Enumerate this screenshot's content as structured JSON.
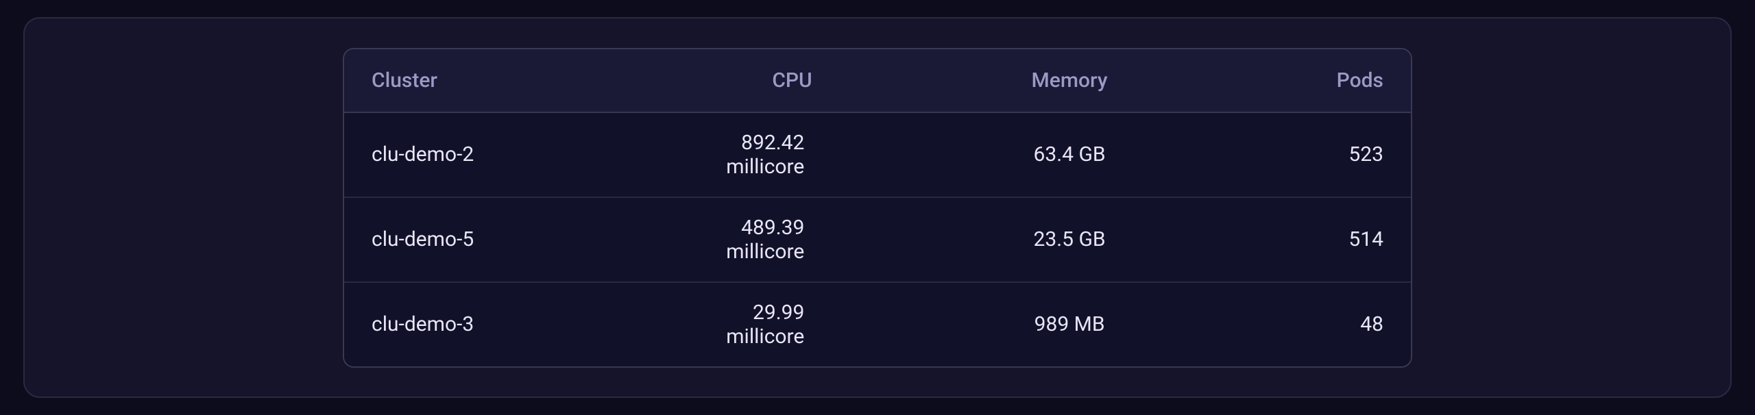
{
  "table": {
    "headers": {
      "cluster": "Cluster",
      "cpu": "CPU",
      "memory": "Memory",
      "pods": "Pods"
    },
    "rows": [
      {
        "cluster": "clu-demo-2",
        "cpu": "892.42 millicore",
        "memory": "63.4 GB",
        "pods": "523"
      },
      {
        "cluster": "clu-demo-5",
        "cpu": "489.39 millicore",
        "memory": "23.5 GB",
        "pods": "514"
      },
      {
        "cluster": "clu-demo-3",
        "cpu": "29.99 millicore",
        "memory": "989 MB",
        "pods": "48"
      }
    ]
  }
}
